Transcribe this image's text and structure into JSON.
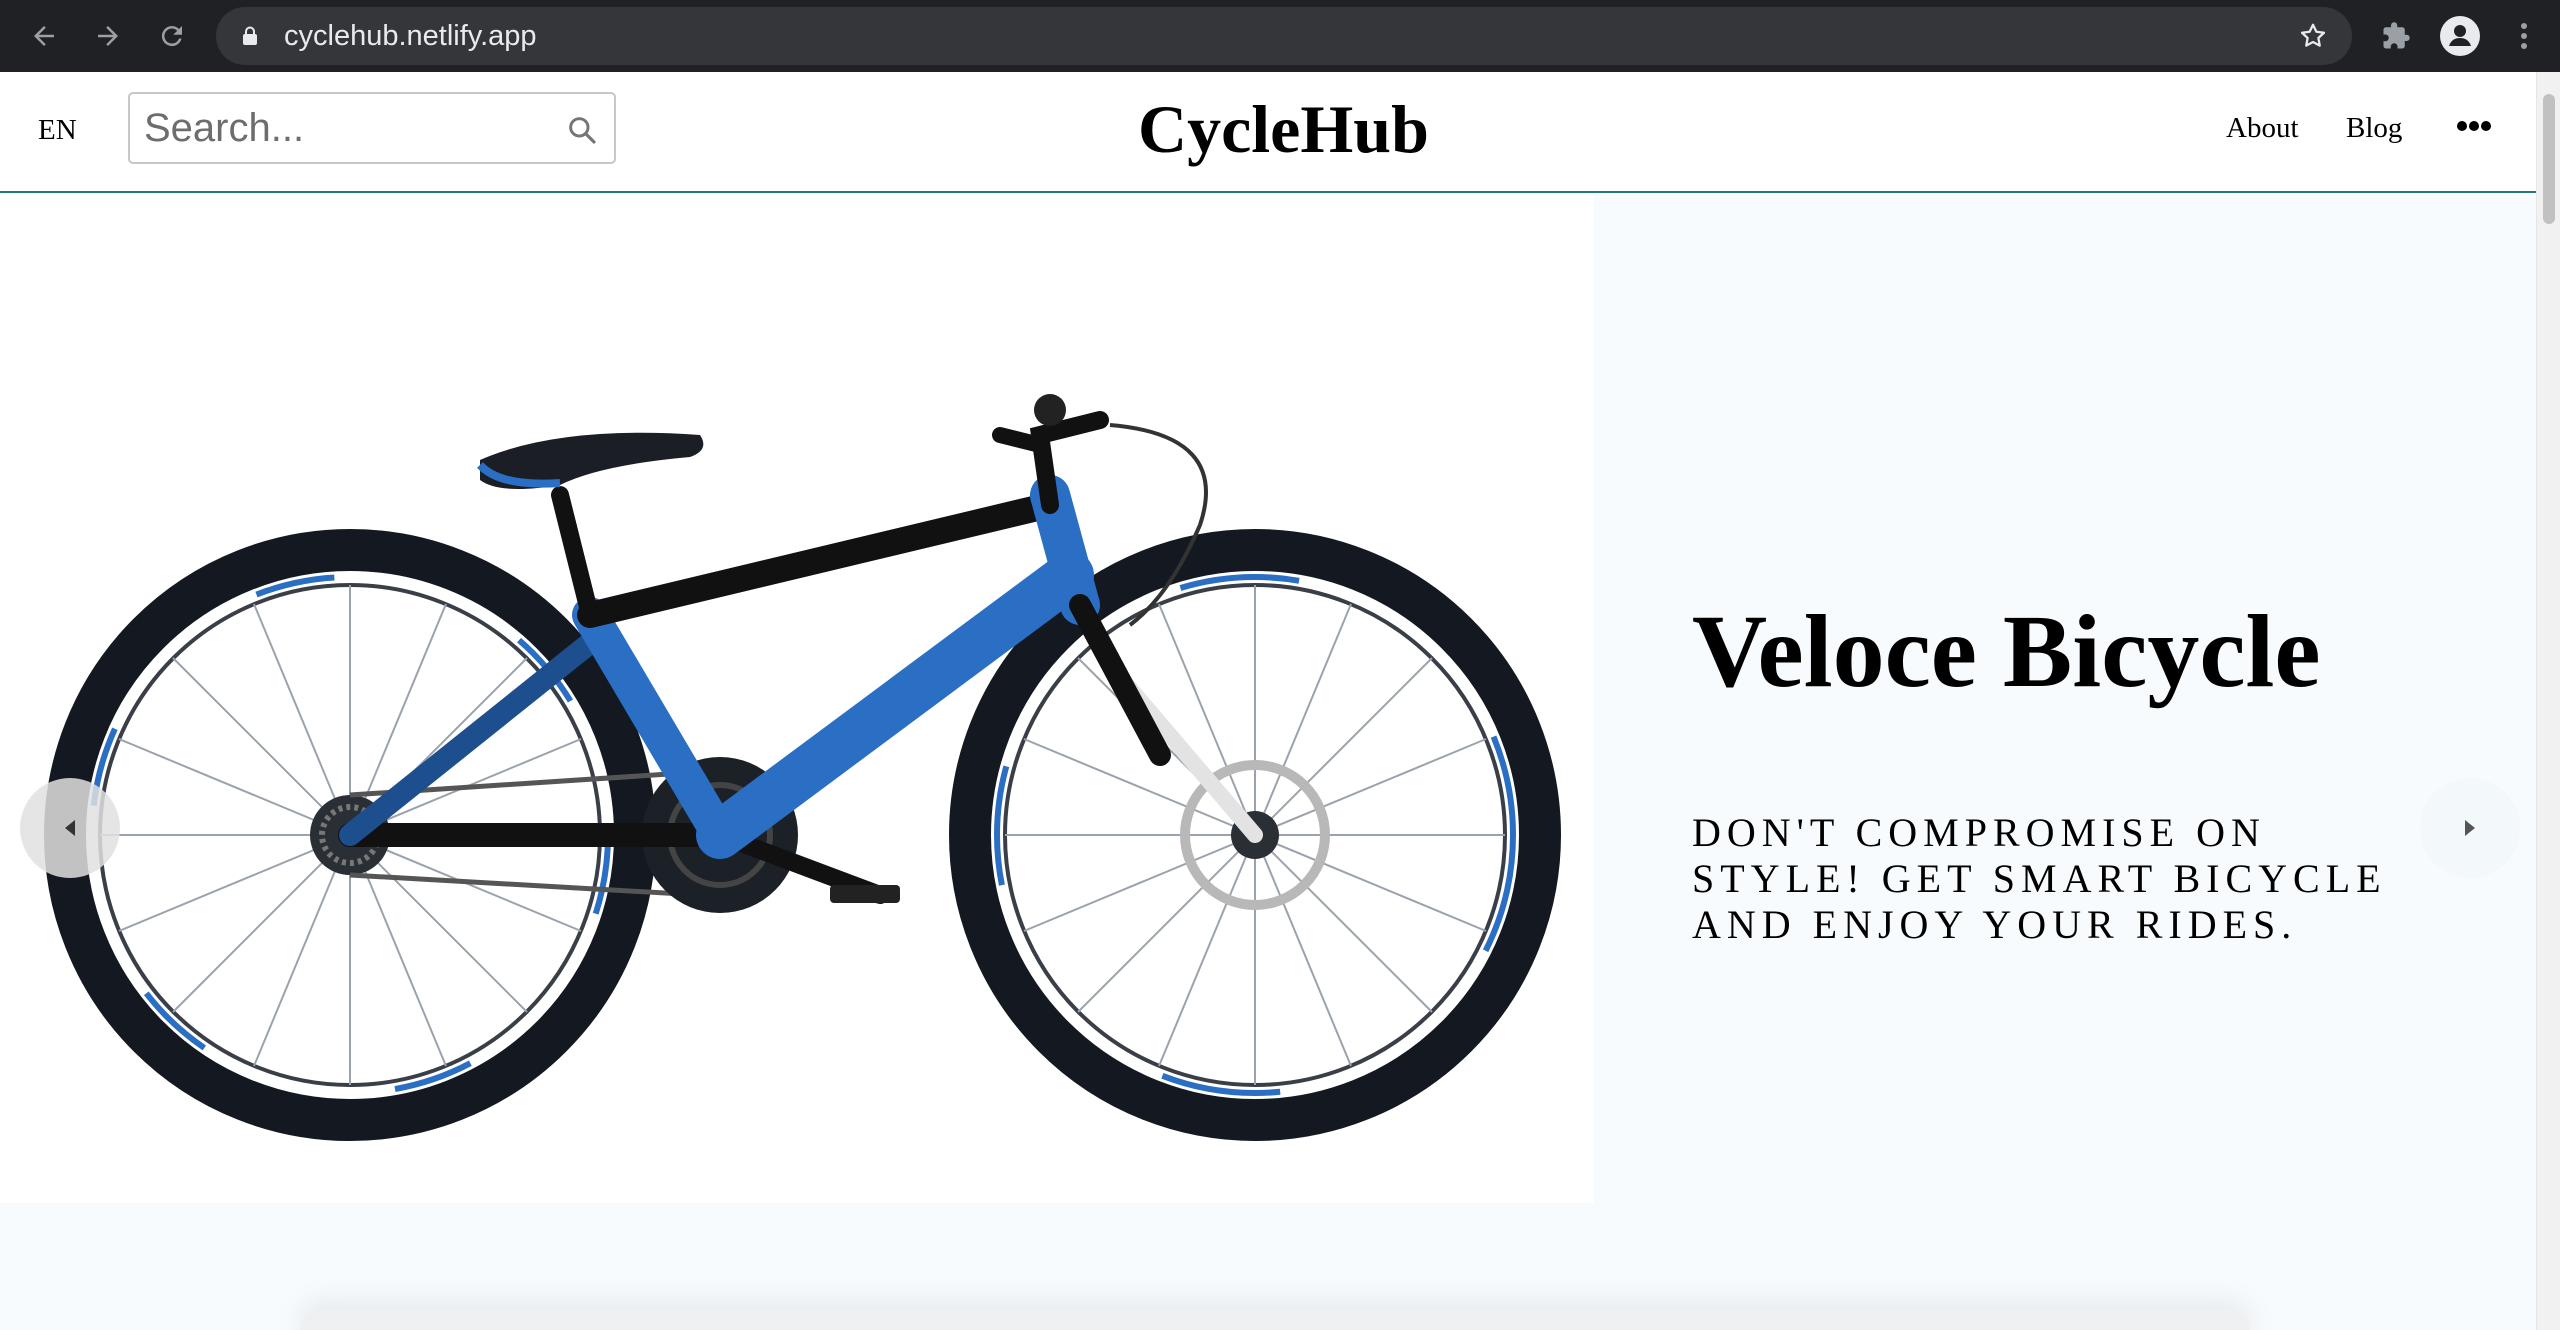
{
  "browser": {
    "url": "cyclehub.netlify.app"
  },
  "header": {
    "language": "EN",
    "search_placeholder": "Search...",
    "brand": "CycleHub",
    "nav": [
      "About",
      "Blog"
    ]
  },
  "hero": {
    "title": "Veloce Bicycle",
    "subtitle": "Don't compromise on style! Get smart bicycle and enjoy your rides."
  },
  "colors": {
    "chrome_bg": "#202124",
    "header_border": "#1f7a73",
    "hero_bg": "#f7fbfd",
    "frame_blue": "#2a6fc4"
  }
}
